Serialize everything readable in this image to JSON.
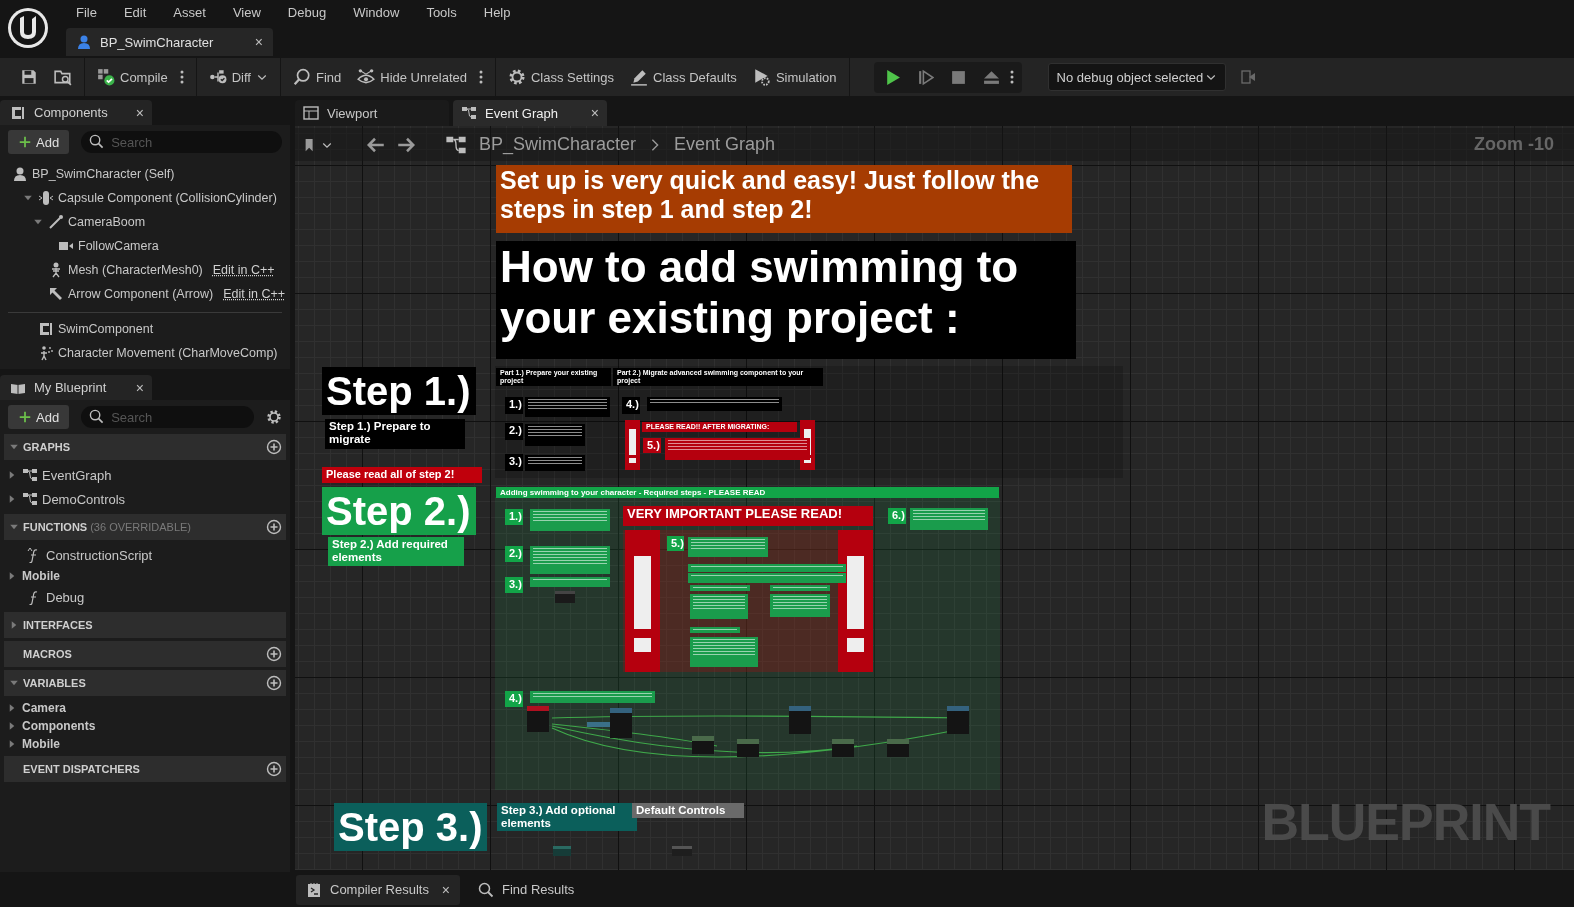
{
  "menu": [
    "File",
    "Edit",
    "Asset",
    "View",
    "Debug",
    "Window",
    "Tools",
    "Help"
  ],
  "document_tab": {
    "label": "BP_SwimCharacter",
    "close": "×"
  },
  "toolbar": [
    [
      {
        "kind": "save"
      },
      {
        "kind": "browse"
      }
    ],
    [
      {
        "kind": "compile",
        "label": "Compile",
        "more": true
      }
    ],
    [
      {
        "kind": "diff",
        "label": "Diff",
        "dropdown": true
      }
    ],
    [
      {
        "kind": "find",
        "label": "Find"
      },
      {
        "kind": "hide",
        "label": "Hide Unrelated",
        "more": true
      }
    ],
    [
      {
        "kind": "settings",
        "label": "Class Settings"
      },
      {
        "kind": "defaults",
        "label": "Class Defaults"
      },
      {
        "kind": "simulation",
        "label": "Simulation"
      }
    ]
  ],
  "play_controls": [
    {
      "kind": "play"
    },
    {
      "kind": "step"
    },
    {
      "kind": "stop"
    },
    {
      "kind": "eject"
    }
  ],
  "debug_object": {
    "value": "No debug object selected"
  },
  "components": {
    "title": "Components",
    "close": "×",
    "add": "Add",
    "search_placeholder": "Search",
    "tree": [
      {
        "label": "BP_SwimCharacter (Self)",
        "kind": "self",
        "children": [
          {
            "label": "Capsule Component (CollisionCylinder)",
            "kind": "capsule",
            "expanded": true,
            "children": [
              {
                "label": "CameraBoom",
                "kind": "boom",
                "expanded": true,
                "children": [
                  {
                    "label": "FollowCamera",
                    "kind": "camera"
                  }
                ]
              },
              {
                "label": "Mesh (CharacterMesh0)",
                "kind": "mesh",
                "link": "Edit in C++"
              },
              {
                "label": "Arrow Component (Arrow)",
                "kind": "arrow",
                "link": "Edit in C++"
              }
            ]
          }
        ]
      }
    ],
    "extra": [
      {
        "label": "SwimComponent",
        "kind": "component"
      },
      {
        "label": "Character Movement (CharMoveComp)",
        "kind": "movement"
      }
    ]
  },
  "my_blueprint": {
    "title": "My Blueprint",
    "close": "×",
    "add": "Add",
    "search_placeholder": "Search",
    "sections": [
      {
        "title": "GRAPHS",
        "expanded": true,
        "add": true,
        "items": [
          {
            "label": "EventGraph",
            "kind": "graph"
          },
          {
            "label": "DemoControls",
            "kind": "graph"
          }
        ]
      },
      {
        "title": "FUNCTIONS",
        "note": "(36 OVERRIDABLE)",
        "expanded": true,
        "add": true,
        "items": [
          {
            "label": "ConstructionScript",
            "kind": "construction"
          },
          {
            "label": "Mobile",
            "kind": "category"
          },
          {
            "label": "Debug",
            "kind": "function"
          }
        ]
      },
      {
        "title": "INTERFACES",
        "expanded": false
      },
      {
        "title": "MACROS",
        "add": true
      },
      {
        "title": "VARIABLES",
        "expanded": true,
        "add": true,
        "items": [
          {
            "label": "Camera",
            "kind": "category"
          },
          {
            "label": "Components",
            "kind": "category"
          },
          {
            "label": "Mobile",
            "kind": "category"
          }
        ]
      },
      {
        "title": "EVENT DISPATCHERS",
        "add": true
      }
    ]
  },
  "graph_tabs": [
    {
      "label": "Viewport",
      "kind": "viewport",
      "selected": false
    },
    {
      "label": "Event Graph",
      "kind": "graph",
      "selected": true,
      "close": "×"
    }
  ],
  "breadcrumb": [
    "BP_SwimCharacter",
    "Event Graph"
  ],
  "zoom": "Zoom -10",
  "graph_label": "BLUEPRINT",
  "graph": {
    "comments": [
      {
        "text": "Set up is very quick and easy! Just follow the steps in step 1 and step 2!",
        "color": "#a63c02"
      },
      {
        "text": "How to add swimming to your existing project :",
        "color": "#000000"
      },
      {
        "text": "Step 1.)",
        "color": "#000000"
      },
      {
        "text": "Step 1.) Prepare to migrate",
        "color": "#000000"
      },
      {
        "text": "Please read all of step 2!",
        "color": "#c0000c"
      },
      {
        "text": "Step 2.)",
        "color": "#16a04a"
      },
      {
        "text": "Step 2.) Add required elements",
        "color": "#16a04a"
      },
      {
        "text": "Part 1.) Prepare your existing project",
        "color": "#000000"
      },
      {
        "text": "Part 2.) Migrate advanced swimming component to your project",
        "color": "#000000"
      },
      {
        "text": "1.)",
        "color": "#000000"
      },
      {
        "text": "2.)",
        "color": "#000000"
      },
      {
        "text": "3.)",
        "color": "#000000"
      },
      {
        "text": "4.)",
        "color": "#000000"
      },
      {
        "text": "PLEASE READ!! AFTER MIGRATING:",
        "color": "#b5000e"
      },
      {
        "text": "5.)",
        "color": "#b5000e"
      },
      {
        "text": "Adding swimming to your character - Required steps - PLEASE READ",
        "color": "#12a548"
      },
      {
        "text": "1.)",
        "color": "#12a548"
      },
      {
        "text": "VERY IMPORTANT PLEASE READ!",
        "color": "#b5000e"
      },
      {
        "text": "6.)",
        "color": "#12a548"
      },
      {
        "text": "5.)",
        "color": "#12a548"
      },
      {
        "text": "2.)",
        "color": "#12a548"
      },
      {
        "text": "3.)",
        "color": "#12a548"
      },
      {
        "text": "4.)",
        "color": "#12a548"
      },
      {
        "text": "Step 3.)",
        "color": "#0b5f5b"
      },
      {
        "text": "Step 3.) Add optional elements",
        "color": "#0b5f5b"
      },
      {
        "text": "Default Controls",
        "color": "#6a6a6a"
      }
    ]
  },
  "bottom_tabs": [
    {
      "label": "Compiler Results",
      "kind": "log",
      "close": "×"
    },
    {
      "label": "Find Results",
      "kind": "search"
    }
  ]
}
